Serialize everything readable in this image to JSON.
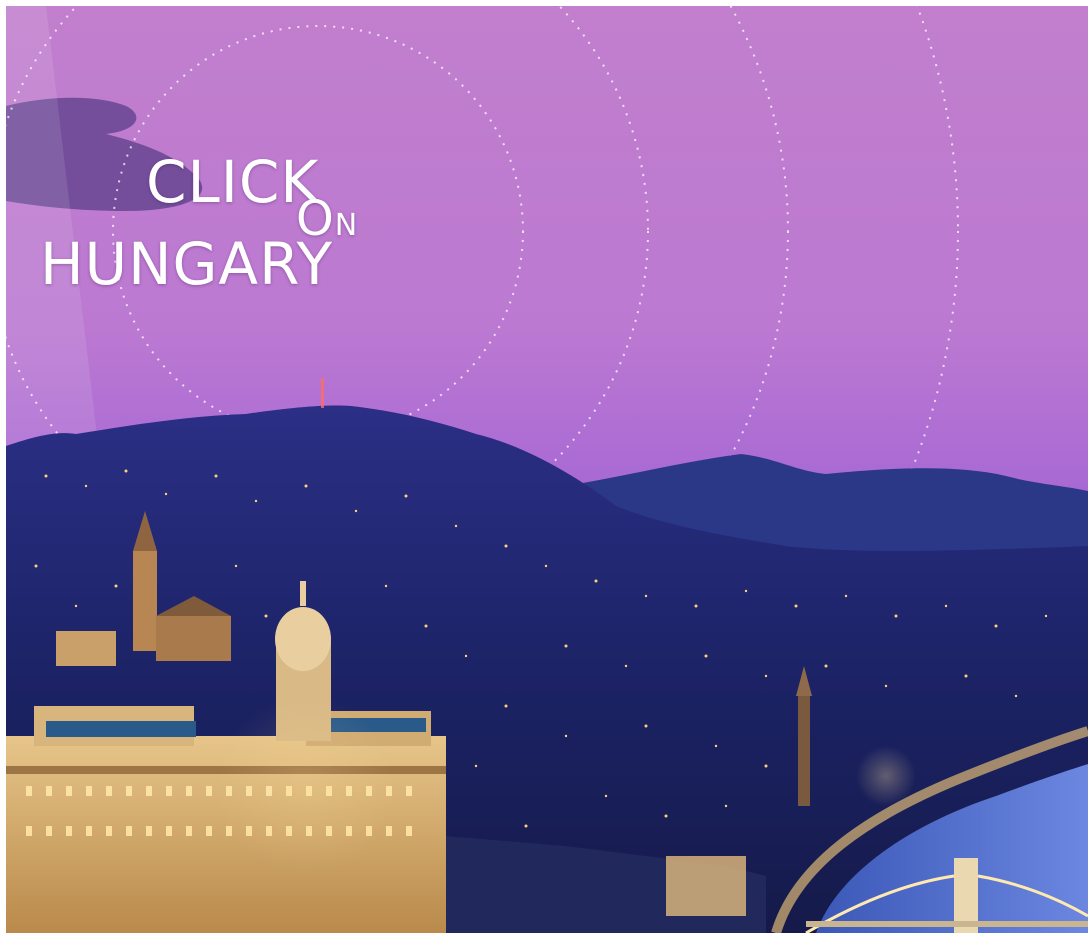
{
  "banner": {
    "line1": "CLICK",
    "line2": "HUNGARY",
    "on_first": "O",
    "on_rest": "N"
  },
  "colors": {
    "sky_top": "#c481d0",
    "sky_bottom": "#9a5fd0",
    "mountains": "#232a78",
    "city_night": "#1a2160",
    "lights": "#ffd27a",
    "river": "#4a6fd0"
  }
}
